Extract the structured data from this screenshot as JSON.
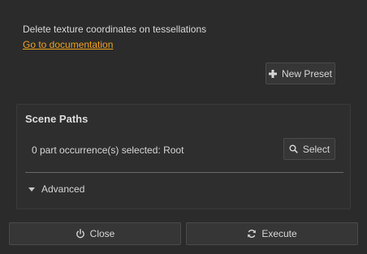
{
  "description": "Delete texture coordinates on tessellations",
  "documentation_link": "Go to documentation",
  "toolbar": {
    "new_preset_label": "New Preset"
  },
  "scene_paths": {
    "title": "Scene Paths",
    "status": "0 part occurrence(s) selected: Root",
    "select_label": "Select",
    "advanced_label": "Advanced"
  },
  "footer": {
    "close_label": "Close",
    "execute_label": "Execute"
  },
  "icons": {
    "new_preset": "plus-icon",
    "select": "search-icon",
    "advanced": "triangle-down-icon",
    "close": "power-icon",
    "execute": "refresh-icon"
  },
  "colors": {
    "link": "#f0a020",
    "background": "#2b2b2b"
  }
}
